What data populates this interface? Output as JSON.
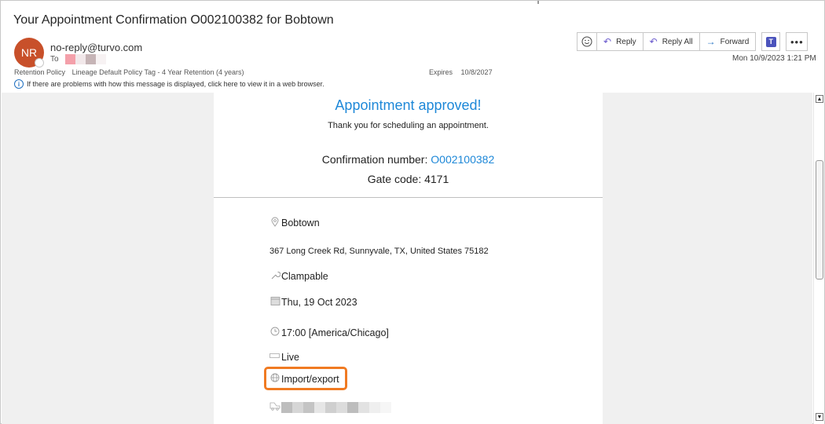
{
  "email": {
    "subject": "Your Appointment Confirmation O002100382 for Bobtown",
    "avatar_initials": "NR",
    "from": "no-reply@turvo.com",
    "to_label": "To",
    "retention_label": "Retention Policy",
    "retention_value": "Lineage Default Policy Tag - 4 Year Retention (4 years)",
    "expires_label": "Expires",
    "expires_value": "10/8/2027",
    "info_message": "If there are problems with how this message is displayed, click here to view it in a web browser.",
    "datetime": "Mon 10/9/2023 1:21 PM"
  },
  "toolbar": {
    "reply_label": "Reply",
    "reply_all_label": "Reply All",
    "forward_label": "Forward",
    "more_label": "•••"
  },
  "body": {
    "headline": "Appointment approved!",
    "thanks": "Thank you for scheduling an appointment.",
    "confirmation_label": "Confirmation number: ",
    "confirmation_number": "O002100382",
    "gate_code": "Gate code: 4171",
    "location": "Bobtown",
    "address": "367 Long Creek Rd, Sunnyvale, TX, United States 75182",
    "dock_type": "Clampable",
    "date": "Thu, 19 Oct 2023",
    "time": "17:00 [America/Chicago]",
    "load_type": "Live",
    "category": "Import/export"
  },
  "colors": {
    "accent_blue": "#1e88d8",
    "avatar_bg": "#c8502a",
    "highlight_orange": "#f07a22",
    "redaction_pink": "#f4a0aa"
  },
  "icons": {
    "location": "map-pin-icon",
    "dock": "wrench-icon",
    "date": "calendar-icon",
    "time": "clock-icon",
    "load": "truck-icon",
    "category": "globe-icon",
    "carrier": "trailer-icon"
  }
}
